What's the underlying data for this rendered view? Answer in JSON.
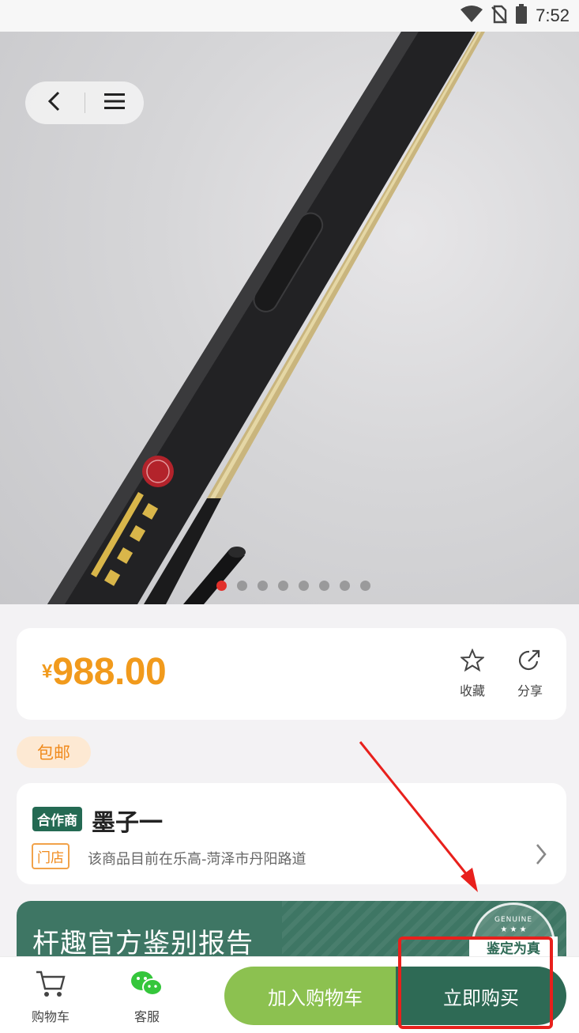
{
  "status_bar": {
    "time": "7:52",
    "icons": [
      "wifi-icon",
      "no-sim-icon",
      "battery-icon"
    ]
  },
  "carousel": {
    "total_images": 8,
    "active_index": 0
  },
  "nav": {
    "icons": [
      "back-icon",
      "menu-icon"
    ]
  },
  "price": {
    "currency": "¥",
    "amount": "988.00"
  },
  "actions": {
    "favorite_label": "收藏",
    "share_label": "分享"
  },
  "shipping_badge": "包邮",
  "store": {
    "partner_tag": "合作商",
    "name": "墨子一",
    "shop_tag": "门店",
    "location": "该商品目前在乐高-菏泽市丹阳路道"
  },
  "report": {
    "title": "杆趣官方鉴别报告",
    "seal_text": "鉴定为真",
    "seal_word": "GENUINE",
    "seal_stars": "★ ★ ★"
  },
  "bottom_bar": {
    "cart_tab_label": "购物车",
    "service_tab_label": "客服",
    "add_to_cart_label": "加入购物车",
    "buy_now_label": "立即购买"
  },
  "colors": {
    "price": "#f19a1c",
    "brand_green": "#2e6a55",
    "cart_button": "#8cc150",
    "annotation_red": "#e8201c"
  }
}
